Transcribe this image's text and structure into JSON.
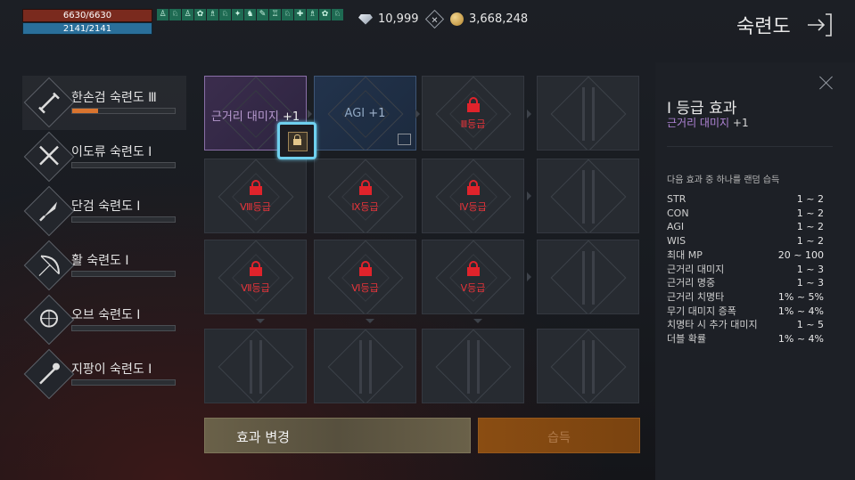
{
  "hud": {
    "hp": "6630/6630",
    "mp": "2141/2141",
    "buffs": [
      "♙",
      "♘",
      "♙",
      "✿",
      "♗",
      "♘",
      "✦",
      "♞",
      "✎",
      "♖",
      "♘",
      "✚",
      "♗",
      "✿",
      "♘"
    ],
    "diamond": "10,999",
    "gold": "3,668,248",
    "title": "숙련도"
  },
  "masteries": [
    {
      "name": "한손검 숙련도 Ⅲ",
      "progress": 0.25,
      "icon": "sword-icon"
    },
    {
      "name": "이도류 숙련도 Ⅰ",
      "progress": 0,
      "icon": "dual-swords-icon"
    },
    {
      "name": "단검 숙련도 Ⅰ",
      "progress": 0,
      "icon": "dagger-icon"
    },
    {
      "name": "활 숙련도 Ⅰ",
      "progress": 0,
      "icon": "bow-icon"
    },
    {
      "name": "오브 숙련도 Ⅰ",
      "progress": 0,
      "icon": "orb-icon"
    },
    {
      "name": "지팡이 숙련도 Ⅰ",
      "progress": 0,
      "icon": "staff-icon"
    }
  ],
  "grid": {
    "active": {
      "label": "근거리 대미지",
      "bonus": "+1"
    },
    "agi": {
      "label": "AGI",
      "bonus": "+1"
    },
    "locks": [
      "Ⅲ등급",
      "Ⅷ등급",
      "Ⅸ등급",
      "Ⅳ등급",
      "Ⅶ등급",
      "Ⅵ등급",
      "Ⅴ등급"
    ]
  },
  "buttons": {
    "change": "효과 변경",
    "learn": "습득"
  },
  "effect": {
    "title": "Ⅰ 등급 효과",
    "sub_label": "근거리 대미지",
    "sub_bonus": "+1",
    "random_heading": "다음 효과 중 하나를 랜덤 습득",
    "stats": [
      {
        "name": "STR",
        "value": "1 ~ 2"
      },
      {
        "name": "CON",
        "value": "1 ~ 2"
      },
      {
        "name": "AGI",
        "value": "1 ~ 2"
      },
      {
        "name": "WIS",
        "value": "1 ~ 2"
      },
      {
        "name": "최대 MP",
        "value": "20 ~ 100"
      },
      {
        "name": "근거리 대미지",
        "value": "1 ~ 3"
      },
      {
        "name": "근거리 명중",
        "value": "1 ~ 3"
      },
      {
        "name": "근거리 치명타",
        "value": "1% ~ 5%"
      },
      {
        "name": "무기 대미지 증폭",
        "value": "1% ~ 4%"
      },
      {
        "name": "치명타 시 추가 대미지",
        "value": "1 ~ 5"
      },
      {
        "name": "더블 확률",
        "value": "1% ~ 4%"
      }
    ]
  }
}
